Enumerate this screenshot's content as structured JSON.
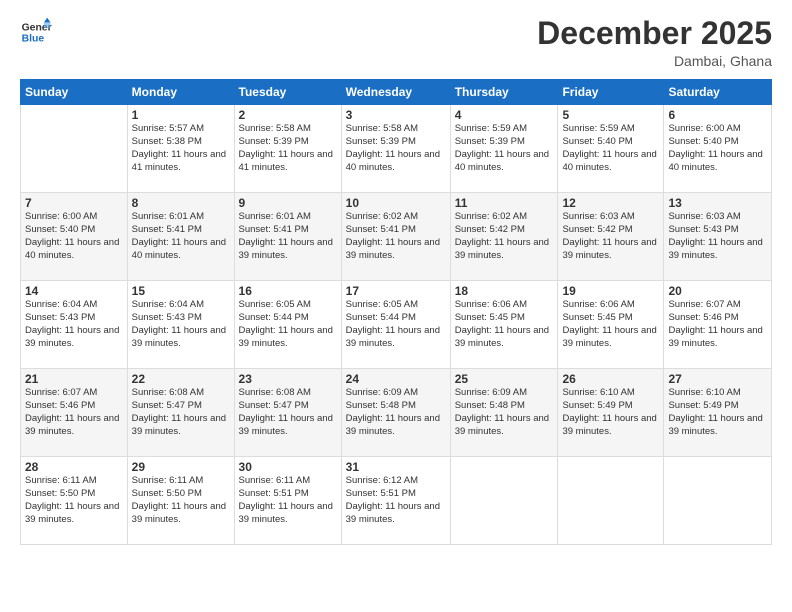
{
  "logo": {
    "line1": "General",
    "line2": "Blue"
  },
  "title": "December 2025",
  "subtitle": "Dambai, Ghana",
  "days_of_week": [
    "Sunday",
    "Monday",
    "Tuesday",
    "Wednesday",
    "Thursday",
    "Friday",
    "Saturday"
  ],
  "weeks": [
    [
      {
        "day": "",
        "sunrise": "",
        "sunset": "",
        "daylight": ""
      },
      {
        "day": "1",
        "sunrise": "Sunrise: 5:57 AM",
        "sunset": "Sunset: 5:38 PM",
        "daylight": "Daylight: 11 hours and 41 minutes."
      },
      {
        "day": "2",
        "sunrise": "Sunrise: 5:58 AM",
        "sunset": "Sunset: 5:39 PM",
        "daylight": "Daylight: 11 hours and 41 minutes."
      },
      {
        "day": "3",
        "sunrise": "Sunrise: 5:58 AM",
        "sunset": "Sunset: 5:39 PM",
        "daylight": "Daylight: 11 hours and 40 minutes."
      },
      {
        "day": "4",
        "sunrise": "Sunrise: 5:59 AM",
        "sunset": "Sunset: 5:39 PM",
        "daylight": "Daylight: 11 hours and 40 minutes."
      },
      {
        "day": "5",
        "sunrise": "Sunrise: 5:59 AM",
        "sunset": "Sunset: 5:40 PM",
        "daylight": "Daylight: 11 hours and 40 minutes."
      },
      {
        "day": "6",
        "sunrise": "Sunrise: 6:00 AM",
        "sunset": "Sunset: 5:40 PM",
        "daylight": "Daylight: 11 hours and 40 minutes."
      }
    ],
    [
      {
        "day": "7",
        "sunrise": "Sunrise: 6:00 AM",
        "sunset": "Sunset: 5:40 PM",
        "daylight": "Daylight: 11 hours and 40 minutes."
      },
      {
        "day": "8",
        "sunrise": "Sunrise: 6:01 AM",
        "sunset": "Sunset: 5:41 PM",
        "daylight": "Daylight: 11 hours and 40 minutes."
      },
      {
        "day": "9",
        "sunrise": "Sunrise: 6:01 AM",
        "sunset": "Sunset: 5:41 PM",
        "daylight": "Daylight: 11 hours and 39 minutes."
      },
      {
        "day": "10",
        "sunrise": "Sunrise: 6:02 AM",
        "sunset": "Sunset: 5:41 PM",
        "daylight": "Daylight: 11 hours and 39 minutes."
      },
      {
        "day": "11",
        "sunrise": "Sunrise: 6:02 AM",
        "sunset": "Sunset: 5:42 PM",
        "daylight": "Daylight: 11 hours and 39 minutes."
      },
      {
        "day": "12",
        "sunrise": "Sunrise: 6:03 AM",
        "sunset": "Sunset: 5:42 PM",
        "daylight": "Daylight: 11 hours and 39 minutes."
      },
      {
        "day": "13",
        "sunrise": "Sunrise: 6:03 AM",
        "sunset": "Sunset: 5:43 PM",
        "daylight": "Daylight: 11 hours and 39 minutes."
      }
    ],
    [
      {
        "day": "14",
        "sunrise": "Sunrise: 6:04 AM",
        "sunset": "Sunset: 5:43 PM",
        "daylight": "Daylight: 11 hours and 39 minutes."
      },
      {
        "day": "15",
        "sunrise": "Sunrise: 6:04 AM",
        "sunset": "Sunset: 5:43 PM",
        "daylight": "Daylight: 11 hours and 39 minutes."
      },
      {
        "day": "16",
        "sunrise": "Sunrise: 6:05 AM",
        "sunset": "Sunset: 5:44 PM",
        "daylight": "Daylight: 11 hours and 39 minutes."
      },
      {
        "day": "17",
        "sunrise": "Sunrise: 6:05 AM",
        "sunset": "Sunset: 5:44 PM",
        "daylight": "Daylight: 11 hours and 39 minutes."
      },
      {
        "day": "18",
        "sunrise": "Sunrise: 6:06 AM",
        "sunset": "Sunset: 5:45 PM",
        "daylight": "Daylight: 11 hours and 39 minutes."
      },
      {
        "day": "19",
        "sunrise": "Sunrise: 6:06 AM",
        "sunset": "Sunset: 5:45 PM",
        "daylight": "Daylight: 11 hours and 39 minutes."
      },
      {
        "day": "20",
        "sunrise": "Sunrise: 6:07 AM",
        "sunset": "Sunset: 5:46 PM",
        "daylight": "Daylight: 11 hours and 39 minutes."
      }
    ],
    [
      {
        "day": "21",
        "sunrise": "Sunrise: 6:07 AM",
        "sunset": "Sunset: 5:46 PM",
        "daylight": "Daylight: 11 hours and 39 minutes."
      },
      {
        "day": "22",
        "sunrise": "Sunrise: 6:08 AM",
        "sunset": "Sunset: 5:47 PM",
        "daylight": "Daylight: 11 hours and 39 minutes."
      },
      {
        "day": "23",
        "sunrise": "Sunrise: 6:08 AM",
        "sunset": "Sunset: 5:47 PM",
        "daylight": "Daylight: 11 hours and 39 minutes."
      },
      {
        "day": "24",
        "sunrise": "Sunrise: 6:09 AM",
        "sunset": "Sunset: 5:48 PM",
        "daylight": "Daylight: 11 hours and 39 minutes."
      },
      {
        "day": "25",
        "sunrise": "Sunrise: 6:09 AM",
        "sunset": "Sunset: 5:48 PM",
        "daylight": "Daylight: 11 hours and 39 minutes."
      },
      {
        "day": "26",
        "sunrise": "Sunrise: 6:10 AM",
        "sunset": "Sunset: 5:49 PM",
        "daylight": "Daylight: 11 hours and 39 minutes."
      },
      {
        "day": "27",
        "sunrise": "Sunrise: 6:10 AM",
        "sunset": "Sunset: 5:49 PM",
        "daylight": "Daylight: 11 hours and 39 minutes."
      }
    ],
    [
      {
        "day": "28",
        "sunrise": "Sunrise: 6:11 AM",
        "sunset": "Sunset: 5:50 PM",
        "daylight": "Daylight: 11 hours and 39 minutes."
      },
      {
        "day": "29",
        "sunrise": "Sunrise: 6:11 AM",
        "sunset": "Sunset: 5:50 PM",
        "daylight": "Daylight: 11 hours and 39 minutes."
      },
      {
        "day": "30",
        "sunrise": "Sunrise: 6:11 AM",
        "sunset": "Sunset: 5:51 PM",
        "daylight": "Daylight: 11 hours and 39 minutes."
      },
      {
        "day": "31",
        "sunrise": "Sunrise: 6:12 AM",
        "sunset": "Sunset: 5:51 PM",
        "daylight": "Daylight: 11 hours and 39 minutes."
      },
      {
        "day": "",
        "sunrise": "",
        "sunset": "",
        "daylight": ""
      },
      {
        "day": "",
        "sunrise": "",
        "sunset": "",
        "daylight": ""
      },
      {
        "day": "",
        "sunrise": "",
        "sunset": "",
        "daylight": ""
      }
    ]
  ]
}
